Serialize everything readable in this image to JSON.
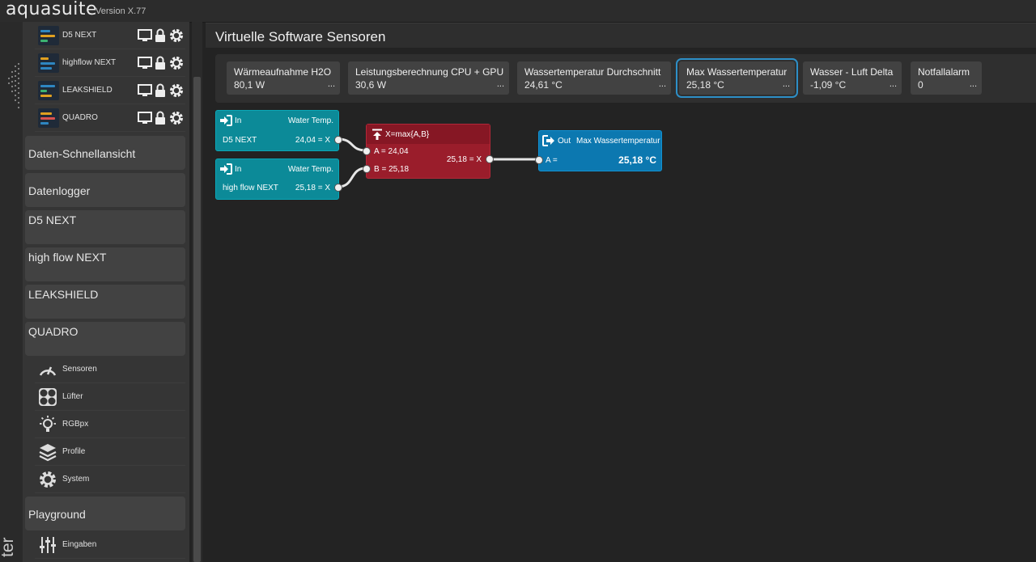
{
  "app": {
    "name": "aquasuite",
    "version": "Version X.77",
    "side_label": "ter"
  },
  "sidebar": {
    "devices": [
      {
        "name": "D5 NEXT"
      },
      {
        "name": "highflow NEXT"
      },
      {
        "name": "LEAKSHIELD"
      },
      {
        "name": "QUADRO"
      }
    ],
    "buttons": [
      {
        "label": "Daten-Schnellansicht"
      },
      {
        "label": "Datenlogger"
      },
      {
        "label": "D5 NEXT"
      },
      {
        "label": "high flow NEXT"
      },
      {
        "label": "LEAKSHIELD"
      },
      {
        "label": "QUADRO"
      }
    ],
    "quadro_items": [
      {
        "label": "Sensoren",
        "icon": "gauge-icon"
      },
      {
        "label": "Lüfter",
        "icon": "fan-icon"
      },
      {
        "label": "RGBpx",
        "icon": "lightbulb-icon"
      },
      {
        "label": "Profile",
        "icon": "layers-icon"
      },
      {
        "label": "System",
        "icon": "gear-icon"
      }
    ],
    "playground": {
      "label": "Playground"
    },
    "playground_items": [
      {
        "label": "Eingaben",
        "icon": "sliders-icon"
      }
    ]
  },
  "main": {
    "title": "Virtuelle Software Sensoren",
    "sensors": [
      {
        "title": "Wärmeaufnahme H2O",
        "value": "80,1 W",
        "more": "..."
      },
      {
        "title": "Leistungsberechnung CPU + GPU",
        "value": "30,6 W",
        "more": "..."
      },
      {
        "title": "Wassertemperatur Durchschnitt",
        "value": "24,61 °C",
        "more": "..."
      },
      {
        "title": "Max Wassertemperatur",
        "value": "25,18 °C",
        "more": "...",
        "selected": true
      },
      {
        "title": "Wasser - Luft Delta",
        "value": "-1,09 °C",
        "more": "..."
      },
      {
        "title": "Notfallalarm",
        "value": "0",
        "more": "..."
      }
    ]
  },
  "graph": {
    "input1": {
      "kind": "In",
      "type": "Water Temp.",
      "device": "D5 NEXT",
      "value": "24,04 = X"
    },
    "input2": {
      "kind": "In",
      "type": "Water Temp.",
      "device": "high flow NEXT",
      "value": "25,18 = X"
    },
    "max_node": {
      "formula": "X=max{A,B}",
      "a": "A = 24,04",
      "b": "B = 25,18",
      "result": "25,18 = X"
    },
    "output": {
      "kind": "Out",
      "name": "Max Wassertemperatur",
      "a": "A =",
      "value": "25,18 °C"
    }
  },
  "colors": {
    "accent": "#2d8fc7",
    "input_node": "#0c8a98",
    "function_node": "#9a1d2b",
    "output_node": "#0c78b0"
  }
}
